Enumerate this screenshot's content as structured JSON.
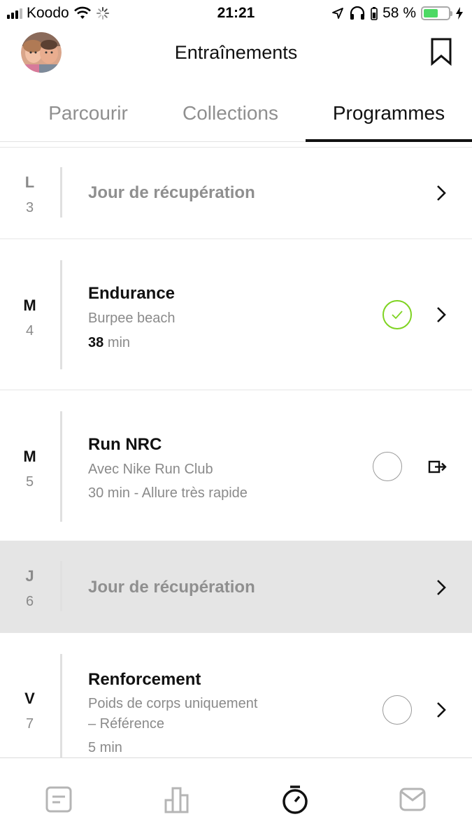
{
  "status_bar": {
    "carrier": "Koodo",
    "time": "21:21",
    "battery_percent": "58 %",
    "battery_level": 0.58
  },
  "header": {
    "title": "Entraînements",
    "avatar_icon": "profile-photo",
    "bookmark_icon": "bookmark-icon"
  },
  "tabs": [
    {
      "label": "Parcourir",
      "active": false
    },
    {
      "label": "Collections",
      "active": false
    },
    {
      "label": "Programmes",
      "active": true
    }
  ],
  "schedule": [
    {
      "day_letter": "L",
      "day_number": "3",
      "type": "rest",
      "title": "Jour de récupération",
      "action": "chevron-right-icon"
    },
    {
      "day_letter": "M",
      "day_number": "4",
      "type": "workout",
      "title": "Endurance",
      "subtitle": "Burpee beach",
      "duration_value": "38",
      "duration_unit": "min",
      "completed": true,
      "action": "chevron-right-icon"
    },
    {
      "day_letter": "M",
      "day_number": "5",
      "type": "workout",
      "title": "Run NRC",
      "subtitle": "Avec Nike Run Club",
      "meta": "30 min - Allure très rapide",
      "completed": false,
      "action": "external-link-icon"
    },
    {
      "day_letter": "J",
      "day_number": "6",
      "type": "rest",
      "title": "Jour de récupération",
      "selected": true,
      "action": "chevron-right-icon"
    },
    {
      "day_letter": "V",
      "day_number": "7",
      "type": "workout",
      "title": "Renforcement",
      "subtitle_line1": "Poids de corps uniquement",
      "subtitle_line2": "– Référence",
      "meta": "5 min",
      "completed": false,
      "action": "chevron-right-icon"
    }
  ],
  "colors": {
    "accent_green": "#7ed321",
    "selected_row": "#e5e5e5",
    "secondary_text": "#8a8a8a"
  },
  "bottom_nav": [
    {
      "icon": "feed-icon",
      "active": false
    },
    {
      "icon": "activity-chart-icon",
      "active": false
    },
    {
      "icon": "stopwatch-icon",
      "active": true
    },
    {
      "icon": "inbox-icon",
      "active": false
    }
  ]
}
